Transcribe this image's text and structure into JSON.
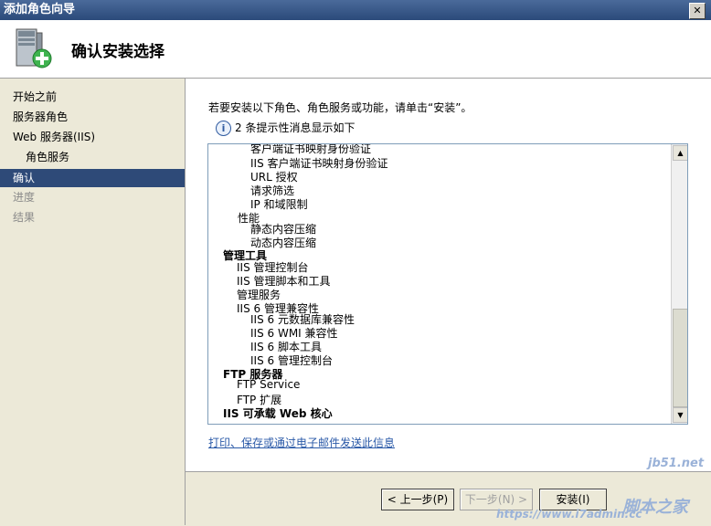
{
  "window": {
    "title": "添加角色向导",
    "close_glyph": "✕"
  },
  "header": {
    "title": "确认安装选择",
    "icon": "server-add-icon"
  },
  "nav": {
    "items": [
      {
        "label": "开始之前",
        "state": "normal"
      },
      {
        "label": "服务器角色",
        "state": "normal"
      },
      {
        "label": "Web 服务器(IIS)",
        "state": "normal"
      },
      {
        "label": "角色服务",
        "state": "normal"
      },
      {
        "label": "确认",
        "state": "active"
      },
      {
        "label": "进度",
        "state": "disabled"
      },
      {
        "label": "结果",
        "state": "disabled"
      }
    ]
  },
  "main": {
    "intro": "若要安装以下角色、角色服务或功能，请单击“安装”。",
    "info_text": "2 条提示性消息显示如下",
    "info_icon": "info-icon",
    "list": [
      "客户端证书映射身份验证",
      "IIS 客户端证书映射身份验证",
      "URL 授权",
      "请求筛选",
      "IP 和域限制",
      "性能",
      "静态内容压缩",
      "动态内容压缩",
      "管理工具",
      "IIS 管理控制台",
      "IIS 管理脚本和工具",
      "管理服务",
      "IIS 6 管理兼容性",
      "IIS 6 元数据库兼容性",
      "IIS 6 WMI 兼容性",
      "IIS 6 脚本工具",
      "IIS 6 管理控制台",
      "FTP 服务器",
      "FTP Service",
      "FTP 扩展",
      "IIS 可承载 Web 核心"
    ],
    "link": "打印、保存或通过电子邮件发送此信息"
  },
  "footer": {
    "back": "< 上一步(P)",
    "next": "下一步(N) >",
    "install": "安装(I)"
  },
  "watermark": {
    "site": "jb51.net",
    "brand": "脚本之家",
    "url": "https://www.i7admin.cc"
  }
}
